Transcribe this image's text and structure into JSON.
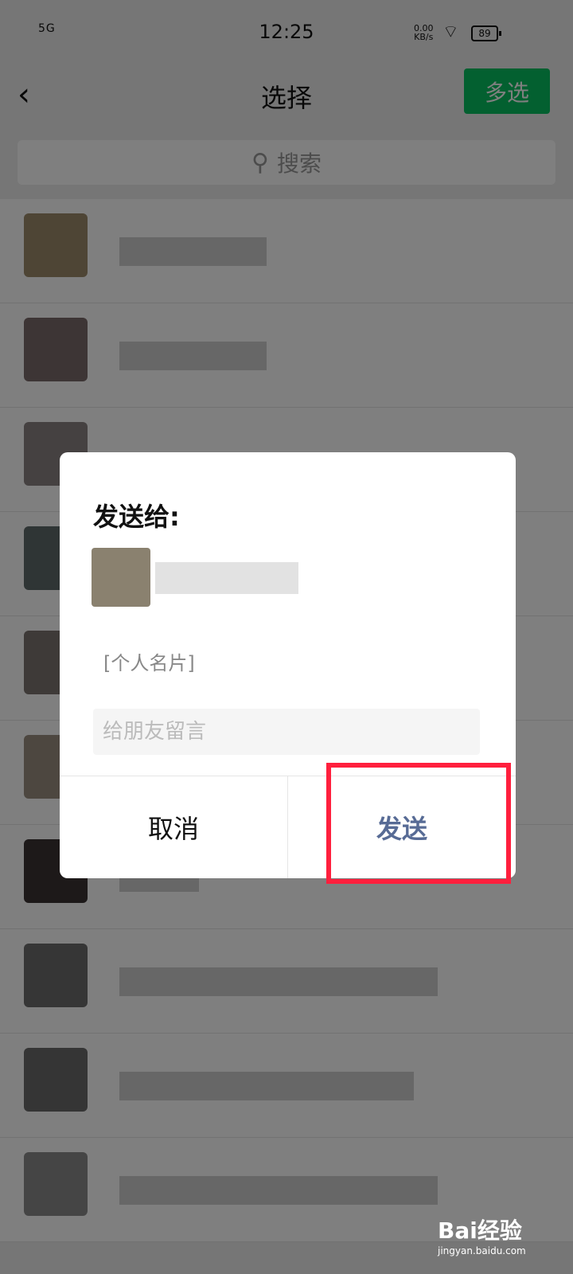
{
  "status_bar": {
    "signal": "5G",
    "time": "12:25",
    "net_speed": "0.00",
    "net_unit": "KB/s",
    "battery": "89"
  },
  "nav": {
    "title": "选择",
    "multi_select": "多选"
  },
  "search": {
    "placeholder": "搜索"
  },
  "dialog": {
    "title": "发送给:",
    "card_label": "[个人名片]",
    "message_placeholder": "给朋友留言",
    "cancel": "取消",
    "send": "发送"
  },
  "watermark": {
    "brand": "Bai经验",
    "url": "jingyan.baidu.com"
  }
}
